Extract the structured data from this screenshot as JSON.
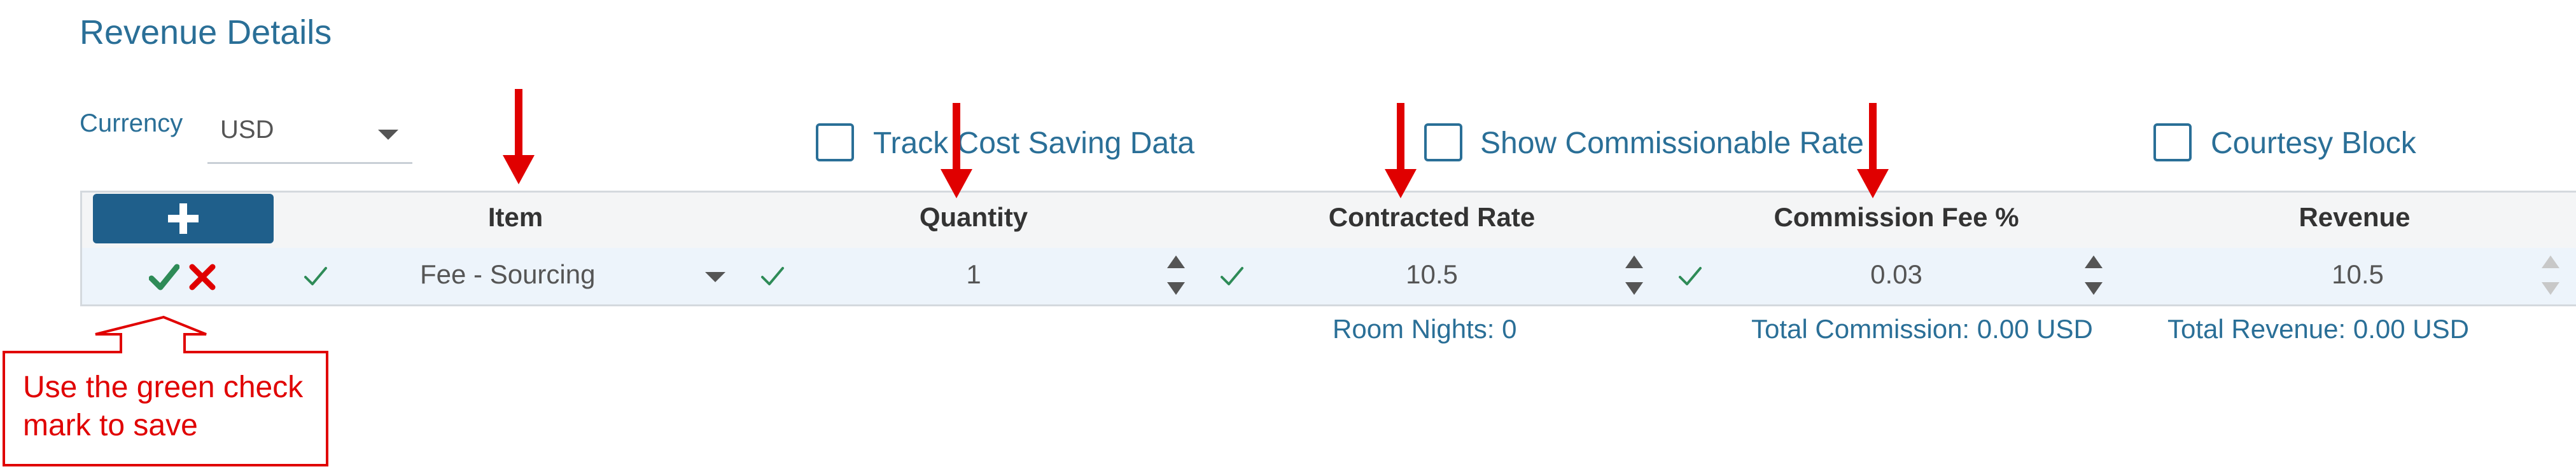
{
  "page": {
    "title": "Revenue Details"
  },
  "currency": {
    "label": "Currency",
    "value": "USD"
  },
  "options": [
    {
      "label": "Track Cost Saving Data",
      "checked": false
    },
    {
      "label": "Show Commissionable Rate",
      "checked": false
    },
    {
      "label": "Courtesy Block",
      "checked": false
    }
  ],
  "table": {
    "add_label": "+",
    "columns": [
      "Item",
      "Quantity",
      "Contracted Rate",
      "Commission Fee %",
      "Revenue"
    ],
    "row": {
      "item": "Fee - Sourcing",
      "quantity": "1",
      "contracted_rate": "10.5",
      "commission_fee": "0.03",
      "revenue": "10.5"
    }
  },
  "totals": {
    "room_nights": "Room Nights: 0",
    "total_commission": "Total Commission: 0.00 USD",
    "total_revenue": "Total Revenue: 0.00 USD"
  },
  "annotation": {
    "line1": "Use the green check",
    "line2": "mark to save"
  },
  "colors": {
    "accent": "#2a6f97",
    "button": "#1f5f8b",
    "save_check": "#2e8b57",
    "cancel_x": "#e00000",
    "callout": "#e00000"
  }
}
